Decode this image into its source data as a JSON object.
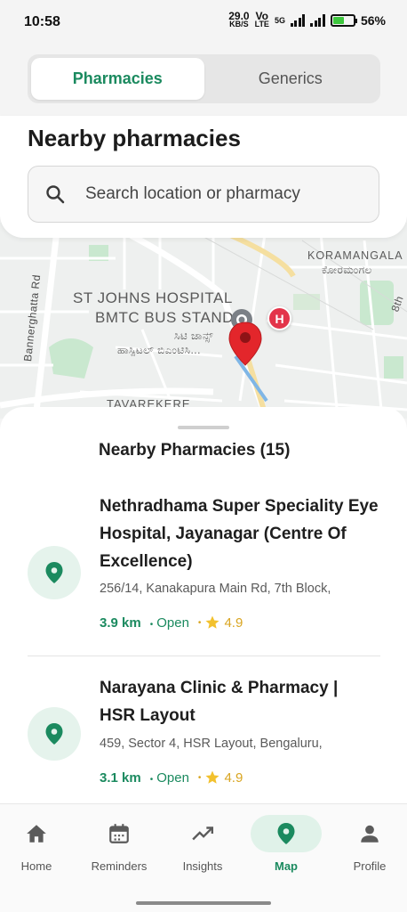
{
  "status_bar": {
    "time": "10:58",
    "speed_value": "29.0",
    "speed_unit": "KB/S",
    "volte_line1": "Vo",
    "volte_line2": "LTE",
    "network": "5G",
    "battery_percent": "56%",
    "battery_level": 0.56
  },
  "tabs": [
    {
      "label": "Pharmacies",
      "active": true
    },
    {
      "label": "Generics",
      "active": false
    }
  ],
  "header": {
    "title": "Nearby pharmacies",
    "search_placeholder": "Search location or pharmacy"
  },
  "map": {
    "labels": {
      "koramangala_en": "KORAMANGALA",
      "koramangala_kn": "ಕೋರಮಂಗಲ",
      "road": "Bannerghatta Rd",
      "hospital_line1": "ST JOHNS HOSPITAL",
      "hospital_line2": "BMTC BUS STAND",
      "hospital_kn_line1": "ಸಿಟಿ ಜಾನ್ಸ್",
      "hospital_kn_line2": "ಹಾಸ್ಪಿಟಲ್ ಬಿಎಂಟಿಸಿ...",
      "area": "TAVAREKERE",
      "cross": "8th"
    },
    "hospital_marker": "H"
  },
  "sheet": {
    "title": "Nearby Pharmacies (15)",
    "items": [
      {
        "name": "Nethradhama Super Speciality Eye Hospital, Jayanagar (Centre Of Excellence)",
        "address": "256/14, Kanakapura Main Rd, 7th Block,",
        "distance": "3.9 km",
        "status": "Open",
        "rating": "4.9"
      },
      {
        "name": "Narayana Clinic & Pharmacy | HSR Layout",
        "address": "459, Sector 4, HSR Layout, Bengaluru,",
        "distance": "3.1 km",
        "status": "Open",
        "rating": "4.9"
      }
    ]
  },
  "nav": [
    {
      "label": "Home",
      "icon": "home-icon",
      "active": false
    },
    {
      "label": "Reminders",
      "icon": "calendar-icon",
      "active": false
    },
    {
      "label": "Insights",
      "icon": "trending-icon",
      "active": false
    },
    {
      "label": "Map",
      "icon": "map-pin-icon",
      "active": true
    },
    {
      "label": "Profile",
      "icon": "person-icon",
      "active": false
    }
  ],
  "colors": {
    "accent": "#1b8a5f",
    "marker_red": "#e3262b",
    "rating": "#d9a521"
  }
}
